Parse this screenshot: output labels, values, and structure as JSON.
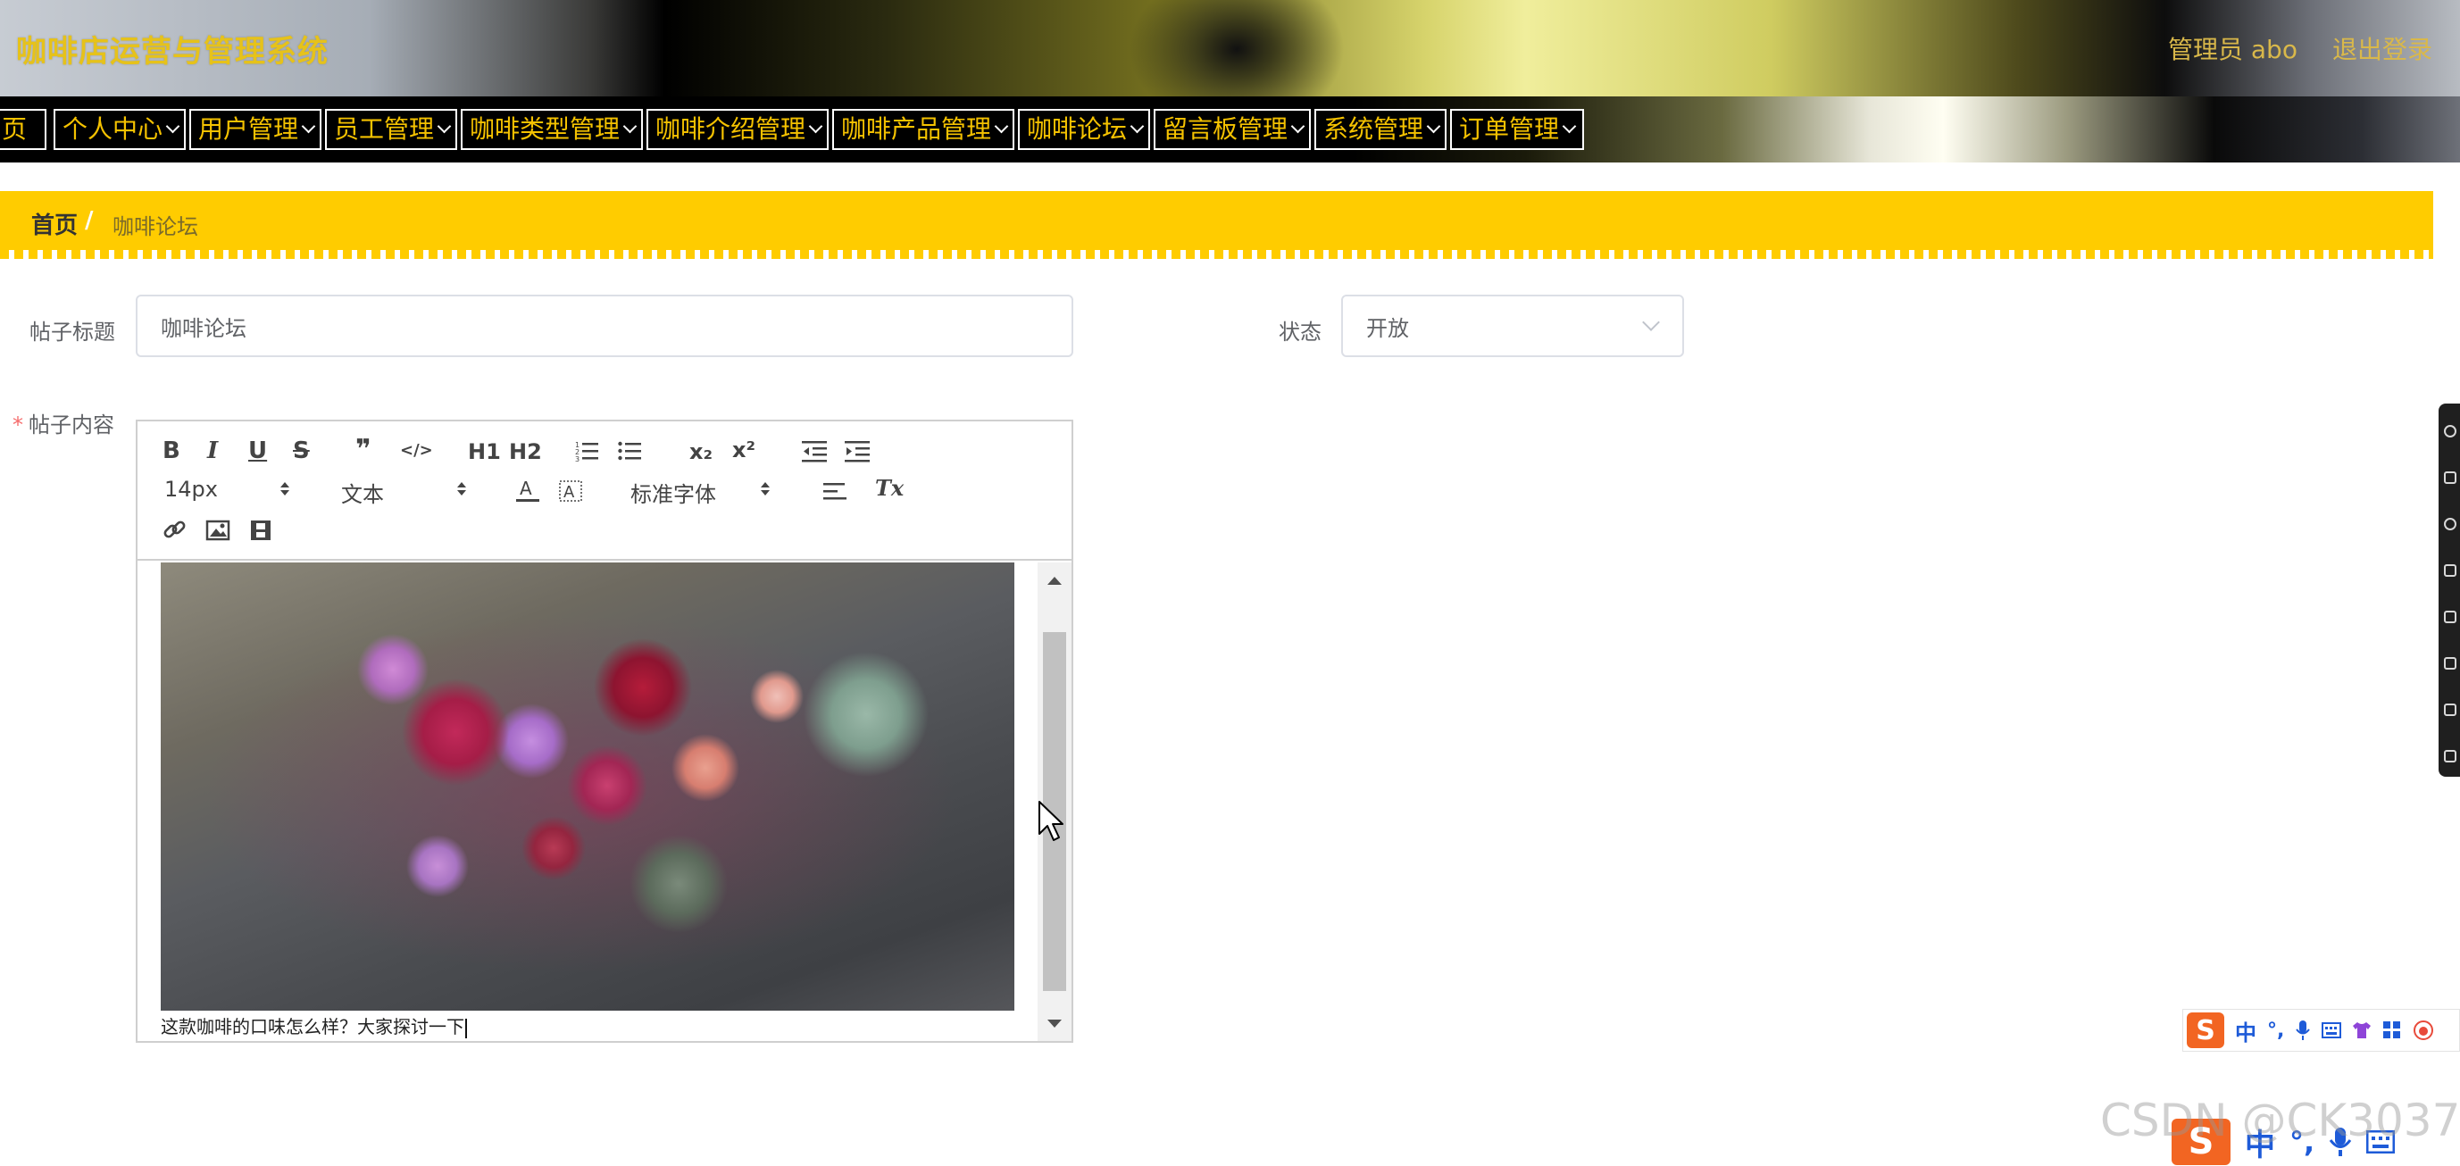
{
  "header": {
    "title": "咖啡店运营与管理系统",
    "admin_label": "管理员 abo",
    "logout_label": "退出登录"
  },
  "nav": {
    "items": [
      {
        "label": "页",
        "has_dropdown": false
      },
      {
        "label": "个人中心",
        "has_dropdown": true
      },
      {
        "label": "用户管理",
        "has_dropdown": true
      },
      {
        "label": "员工管理",
        "has_dropdown": true
      },
      {
        "label": "咖啡类型管理",
        "has_dropdown": true
      },
      {
        "label": "咖啡介绍管理",
        "has_dropdown": true
      },
      {
        "label": "咖啡产品管理",
        "has_dropdown": true
      },
      {
        "label": "咖啡论坛",
        "has_dropdown": true
      },
      {
        "label": "留言板管理",
        "has_dropdown": true
      },
      {
        "label": "系统管理",
        "has_dropdown": true
      },
      {
        "label": "订单管理",
        "has_dropdown": true
      }
    ]
  },
  "breadcrumb": {
    "home": "首页",
    "separator": "/",
    "current": "咖啡论坛"
  },
  "form": {
    "title_label": "帖子标题",
    "title_value": "咖啡论坛",
    "status_label": "状态",
    "status_value": "开放",
    "content_label": "帖子内容",
    "content_required_mark": "*"
  },
  "editor": {
    "toolbar": {
      "bold": "B",
      "italic": "I",
      "underline": "U",
      "strike": "S",
      "quote": "❞",
      "code": "</>",
      "h1": "H1",
      "h2": "H2",
      "subscript": "x₂",
      "superscript": "x²",
      "font_size": "14px",
      "header_select": "文本",
      "font_family": "标准字体",
      "clean": "Tx"
    },
    "text": "这款咖啡的口味怎么样？大家探讨一下"
  },
  "ime": {
    "lang": "中",
    "punct": "°,"
  },
  "watermark": "CSDN @CK3037",
  "colors": {
    "accent_yellow": "#ffcc00",
    "nav_text": "#f5c200",
    "title_gold": "#e6c21a"
  }
}
